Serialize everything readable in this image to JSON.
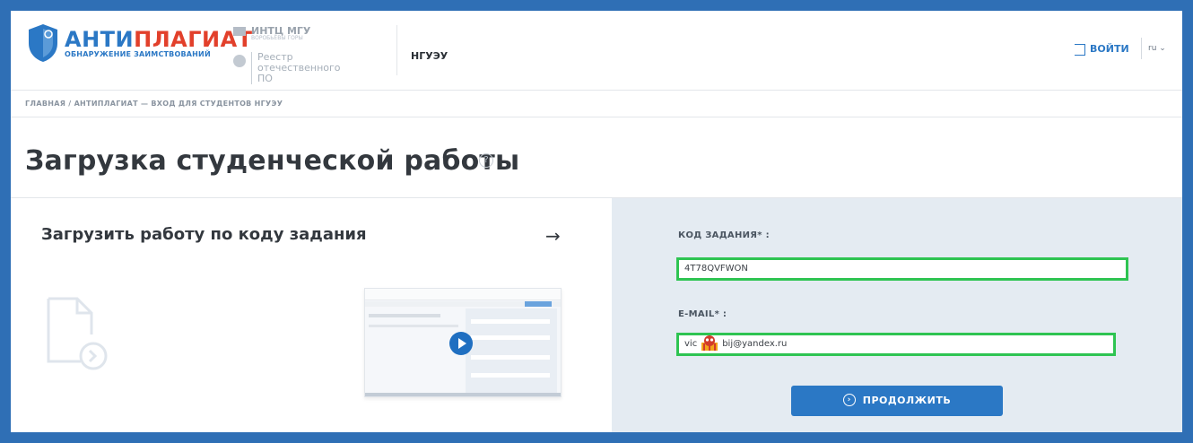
{
  "brand": {
    "name_part1": "АНТИ",
    "name_part2": "ПЛАГИАТ",
    "tagline": "ОБНАРУЖЕНИЕ ЗАИМСТВОВАНИЙ",
    "colors": {
      "blue": "#2b78c5",
      "red": "#e2402b"
    }
  },
  "partners": {
    "first": "ИНТЦ МГУ",
    "first_sub": "ВОРОБЬЁВЫ ГОРЫ",
    "second": "Реестр отечественного ПО"
  },
  "header": {
    "org": "НГУЭУ",
    "login_label": "ВОЙТИ",
    "lang": "ru",
    "lang_caret": "⌄"
  },
  "breadcrumb": "ГЛАВНАЯ / АНТИПЛАГИАТ — ВХОД ДЛЯ СТУДЕНТОВ НГУЭУ",
  "page": {
    "title": "Загрузка студенческой работы",
    "help_symbol": "?"
  },
  "left_card": {
    "title": "Загрузить работу по коду задания",
    "arrow": "→",
    "preview_icon": "video-preview",
    "doc_icon": "document-upload-icon"
  },
  "form": {
    "code_label": "КОД ЗАДАНИЯ* :",
    "code_value": "4T78QVFWON",
    "email_label": "E-MAIL* :",
    "email_prefix": "vic",
    "email_suffix": "bij@yandex.ru",
    "submit_label": "ПРОДОЛЖИТЬ",
    "highlight_color": "#2ec452"
  }
}
